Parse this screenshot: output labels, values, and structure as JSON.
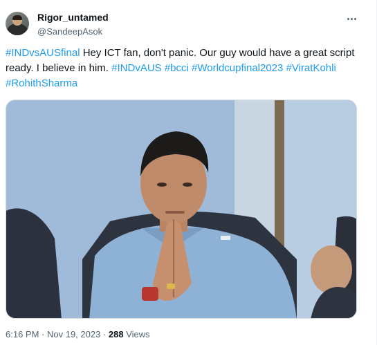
{
  "author": {
    "name": "Rigor_untamed",
    "handle": "@SandeepAsok"
  },
  "icons": {
    "avatar": "user-avatar",
    "more": "more-options-icon"
  },
  "tweet": {
    "hashtag_1": "#INDvsAUSfinal",
    "text_1": " Hey ICT fan, don't panic. Our guy would have a great script ready. I believe in him. ",
    "hashtag_2": "#INDvAUS",
    "hashtag_3": "#bcci",
    "hashtag_4": "#Worldcupfinal2023",
    "hashtag_5": "#ViratKohli",
    "hashtag_6": "#RohithSharma"
  },
  "meta": {
    "time": "6:16 PM",
    "sep1": " · ",
    "date": "Nov 19, 2023",
    "sep2": " · ",
    "views_count": "288",
    "views_label": " Views"
  },
  "colors": {
    "link": "#1d9bf0",
    "text": "#0f1419",
    "muted": "#536471"
  }
}
